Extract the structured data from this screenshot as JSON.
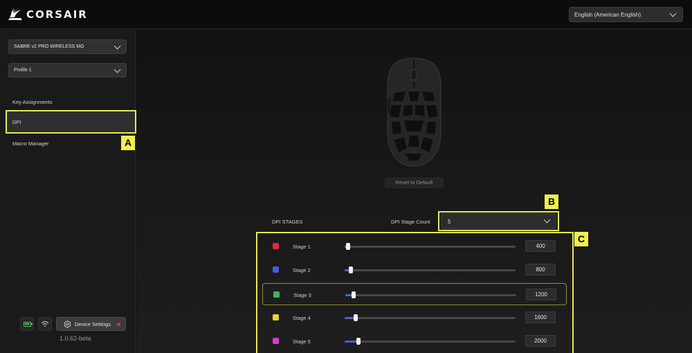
{
  "app": {
    "brand": "CORSAIR",
    "language": "English (American English)"
  },
  "sidebar": {
    "device": "SABRE v2 PRO WIRELESS MG",
    "profile": "Profile 1",
    "nav": [
      {
        "label": "Key Assignments",
        "active": false
      },
      {
        "label": "DPI",
        "active": true
      },
      {
        "label": "Macro Manager",
        "active": false
      }
    ],
    "device_settings_label": "Device Settings",
    "version": "1.0.62-beta"
  },
  "main": {
    "reset_label": "Reset to Default",
    "stages_heading": "DPI STAGES",
    "stage_count_label": "DPI Stage Count",
    "stage_count_value": "5",
    "stages": [
      {
        "name": "Stage 1",
        "color": "#e8254a",
        "dpi": "400",
        "fraction": 0.0,
        "selected": false
      },
      {
        "name": "Stage 2",
        "color": "#3c5ee6",
        "dpi": "800",
        "fraction": 0.015,
        "selected": false
      },
      {
        "name": "Stage 3",
        "color": "#3cb45c",
        "dpi": "1200",
        "fraction": 0.03,
        "selected": true
      },
      {
        "name": "Stage 4",
        "color": "#f1d032",
        "dpi": "1600",
        "fraction": 0.045,
        "selected": false
      },
      {
        "name": "Stage 5",
        "color": "#dc3ad0",
        "dpi": "2000",
        "fraction": 0.06,
        "selected": false
      }
    ]
  },
  "callouts": {
    "a": "A",
    "b": "B",
    "c": "C"
  },
  "colors": {
    "highlight": "#e8eb4c",
    "slider_fill": "#3f64e6",
    "battery": "#49d15b"
  }
}
